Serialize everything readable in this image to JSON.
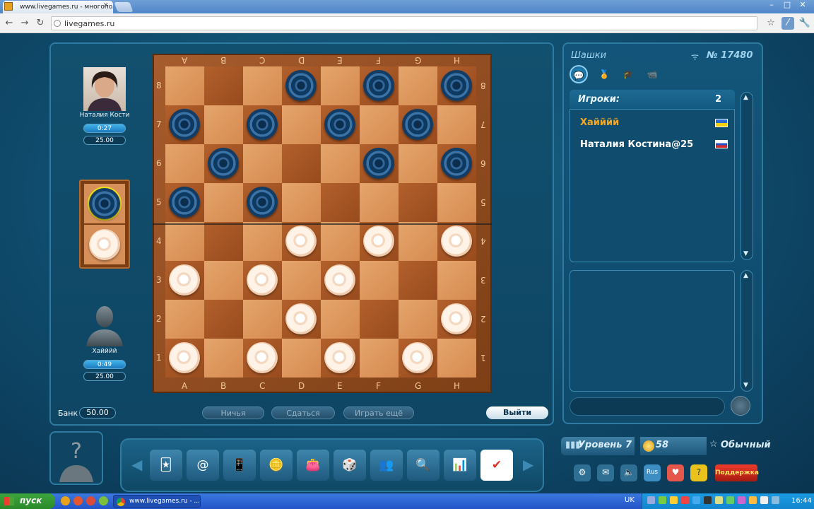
{
  "browser": {
    "tab_title": "www.livegames.ru - многопол",
    "url": "livegames.ru",
    "window_controls": {
      "minimize": "–",
      "maximize": "□",
      "close": "✕"
    },
    "nav": {
      "back": "←",
      "forward": "→",
      "reload": "↻"
    },
    "toolbar_icons": [
      "star-icon",
      "extension-icon",
      "wrench-icon"
    ]
  },
  "game": {
    "title": "Шашки",
    "table_number": "№ 17480",
    "right_tabs": [
      "chat-icon",
      "medal-icon",
      "tables-icon",
      "camera-icon"
    ],
    "players_label": "Игроки:",
    "players_count": "2",
    "players": [
      {
        "name": "Хайййй",
        "color": "#f5a623",
        "flag": "Ukraine"
      },
      {
        "name": "Наталия Костина@25",
        "color": "#ffffff",
        "flag": "Russia"
      }
    ],
    "opponent": {
      "name": "Наталия Кости",
      "time": "0:27",
      "stake": "25.00"
    },
    "me": {
      "name": "Хайййй",
      "time": "0:49",
      "stake": "25.00"
    },
    "bank_label": "Банк",
    "bank_value": "50.00",
    "buttons": {
      "draw": "Ничья",
      "resign": "Сдаться",
      "play_again": "Играть ещё",
      "exit": "Выйти"
    },
    "level": "Уровень 7",
    "coins": "58",
    "status": "Обычный",
    "support": "Поддержка",
    "lang_btn": "Rus",
    "board": {
      "files": [
        "A",
        "B",
        "C",
        "D",
        "E",
        "F",
        "G",
        "H"
      ],
      "ranks": [
        "8",
        "7",
        "6",
        "5",
        "4",
        "3",
        "2",
        "1"
      ],
      "pieces": [
        {
          "color": "blue",
          "square": "D8"
        },
        {
          "color": "blue",
          "square": "F8"
        },
        {
          "color": "blue",
          "square": "H8"
        },
        {
          "color": "blue",
          "square": "A7"
        },
        {
          "color": "blue",
          "square": "C7"
        },
        {
          "color": "blue",
          "square": "E7"
        },
        {
          "color": "blue",
          "square": "G7"
        },
        {
          "color": "blue",
          "square": "B6"
        },
        {
          "color": "blue",
          "square": "F6"
        },
        {
          "color": "blue",
          "square": "H6"
        },
        {
          "color": "blue",
          "square": "A5"
        },
        {
          "color": "blue",
          "square": "C5"
        },
        {
          "color": "white",
          "square": "D4"
        },
        {
          "color": "white",
          "square": "F4"
        },
        {
          "color": "white",
          "square": "H4"
        },
        {
          "color": "white",
          "square": "A3"
        },
        {
          "color": "white",
          "square": "C3"
        },
        {
          "color": "white",
          "square": "E3"
        },
        {
          "color": "white",
          "square": "D2"
        },
        {
          "color": "white",
          "square": "H2"
        },
        {
          "color": "white",
          "square": "A1"
        },
        {
          "color": "white",
          "square": "C1"
        },
        {
          "color": "white",
          "square": "E1"
        },
        {
          "color": "white",
          "square": "G1"
        }
      ]
    },
    "dock_items": [
      "poker-icon",
      "mail-100-icon",
      "phone-1000-icon",
      "coin-clock-icon",
      "wallet-icon",
      "games-icon",
      "friends-icon",
      "search-icon",
      "stats-chart-icon",
      "vote-icon"
    ],
    "bottom_icons": [
      "settings-icon",
      "mail-icon",
      "sound-icon",
      "language-icon",
      "heart-icon",
      "help-icon"
    ]
  },
  "taskbar": {
    "start": "пуск",
    "task": "www.livegames.ru - ...",
    "lang": "UK",
    "clock": "16:44"
  }
}
